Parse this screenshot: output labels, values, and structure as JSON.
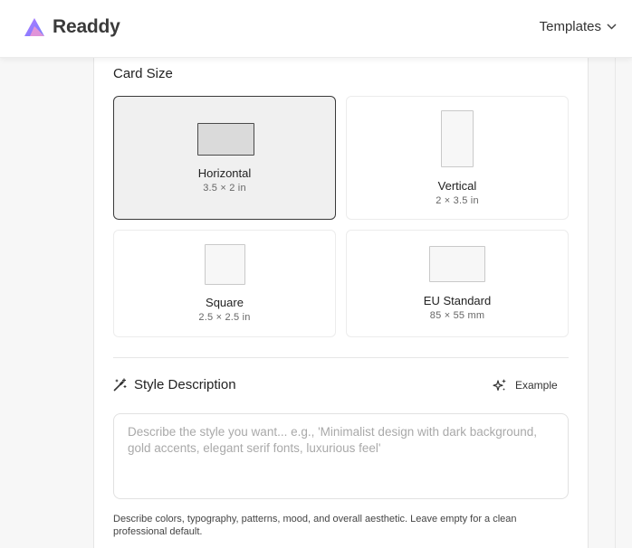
{
  "header": {
    "brand": "Readdy",
    "templates_label": "Templates",
    "brand_colors": [
      "#a66cff",
      "#6f7dff",
      "#ff8fc7"
    ]
  },
  "card_size": {
    "title": "Card Size",
    "options": [
      {
        "label": "Horizontal",
        "dimensions": "3.5 × 2 in",
        "selected": true
      },
      {
        "label": "Vertical",
        "dimensions": "2 × 3.5 in",
        "selected": false
      },
      {
        "label": "Square",
        "dimensions": "2.5 × 2.5 in",
        "selected": false
      },
      {
        "label": "EU Standard",
        "dimensions": "85 × 55 mm",
        "selected": false
      }
    ]
  },
  "style_description": {
    "title": "Style Description",
    "example_label": "Example",
    "value": "",
    "placeholder": "Describe the style you want... e.g., 'Minimalist design with dark background, gold accents, elegant serif fonts, luxurious feel'",
    "help_text": "Describe colors, typography, patterns, mood, and overall aesthetic. Leave empty for a clean professional default."
  }
}
